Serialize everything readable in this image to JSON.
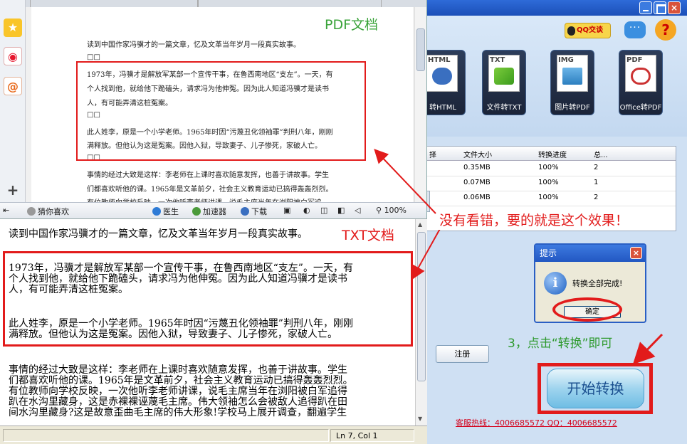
{
  "converter": {
    "qq_label": "QQ交谈",
    "tools": [
      {
        "tag": "HTML",
        "label": "转HTML"
      },
      {
        "tag": "TXT",
        "label": "文件转TXT"
      },
      {
        "tag": "IMG",
        "label": "图片转PDF"
      },
      {
        "tag": "PDF",
        "label": "Office转PDF"
      }
    ],
    "grid": {
      "headers": [
        "择",
        "文件大小",
        "转换进度",
        "总..."
      ],
      "rows": [
        [
          "",
          "0.35MB",
          "100%",
          "2"
        ],
        [
          "",
          "0.07MB",
          "100%",
          "1"
        ],
        [
          "",
          "0.06MB",
          "100%",
          "2"
        ]
      ]
    },
    "register_label": "注册",
    "start_label": "开始转换",
    "hotline": "客服热线：4006685572 QQ：4006685572",
    "step_text": "3，点击“转换”即可"
  },
  "dialog": {
    "title": "提示",
    "message": "转换全部完成!",
    "ok_label": "确定"
  },
  "pdf": {
    "watermark": "PDF文档",
    "lines": [
      "读到中国作家冯骥才的一篇文章，忆及文革当年岁月一段真实故事。",
      "□□",
      "1973年，冯骥才是解放军某部一个宣传干事，在鲁西南地区“支左”。一天，有",
      "个人找到他，就给他下跪磕头，请求冯为他伸冤。因为此人知道冯骥才是读书",
      "人，有可能弄清这桩冤案。",
      "□□",
      "此人姓李，原是一个小学老师。1965年时因“污蔑丑化领袖罪”判刑八年，刚刚",
      "满释放。但他认为这是冤案。因他入狱，导致妻子、儿子惨死，家破人亡。",
      "□□",
      "事情的经过大致是这样：李老师在上课时喜欢随意发挥，也善于讲故事。学生",
      "们都喜欢听他的课。1965年是文革前夕，社会主义教育运动已搞得轰轰烈烈。",
      "有位教师向学校反映，一次他听李老师讲课，说毛主席当年在浏阳被白军追"
    ],
    "status": {
      "like": "猜你喜欢",
      "doctor": "医生",
      "accelerator": "加速器",
      "download": "下载",
      "zoom": "100%"
    }
  },
  "txt": {
    "watermark": "TXT文档",
    "lines": [
      "读到中国作家冯骥才的一篇文章，忆及文革当年岁月一段真实故事。",
      "1973年，冯骥才是解放军某部一个宣传干事，在鲁西南地区“支左”。一天，有",
      "个人找到他，就给他下跪磕头，请求冯为他伸冤。因为此人知道冯骥才是读书",
      "人，有可能弄清这桩冤案。",
      "此人姓李，原是一个小学老师。1965年时因“污蔑丑化领袖罪”判刑八年，刚刚",
      "满释放。但他认为这是冤案。因他入狱，导致妻子、儿子惨死，家破人亡。",
      "事情的经过大致是这样：李老师在上课时喜欢随意发挥，也善于讲故事。学生",
      "们都喜欢听他的课。1965年是文革前夕，社会主义教育运动已搞得轰轰烈烈。",
      "有位教师向学校反映，一次他听李老师讲课，说毛主席当年在浏阳被白军追得",
      "趴在水沟里藏身，这是赤裸裸诬蔑毛主席。伟大领袖怎么会被敌人追得趴在田",
      "间水沟里藏身?这是故意歪曲毛主席的伟大形象!学校马上展开调查，翻遍学生"
    ],
    "status_pos": "Ln 7, Col 1"
  },
  "annotation": "没有看错，要的就是这个效果！"
}
